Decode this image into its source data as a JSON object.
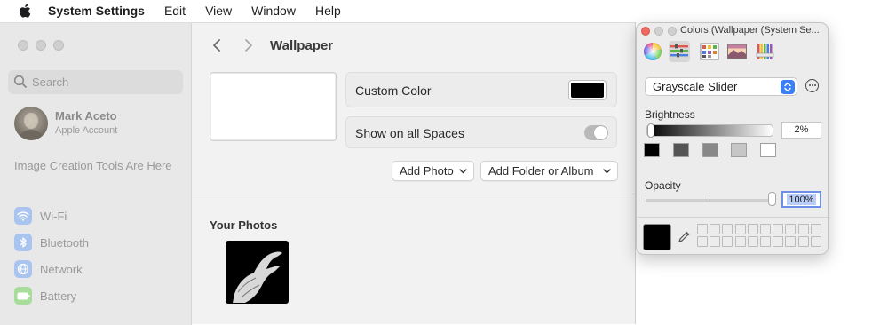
{
  "menubar": {
    "app_name": "System Settings",
    "items": [
      "Edit",
      "View",
      "Window",
      "Help"
    ]
  },
  "settings": {
    "search": {
      "placeholder": "Search"
    },
    "user": {
      "name": "Mark Aceto",
      "subtitle": "Apple Account"
    },
    "promo": "Image Creation Tools Are Here",
    "sidebar_items": [
      {
        "label": "Wi-Fi",
        "icon": "wifi-icon",
        "color": "#a9c4ee"
      },
      {
        "label": "Bluetooth",
        "icon": "bluetooth-icon",
        "color": "#a9c4ee"
      },
      {
        "label": "Network",
        "icon": "globe-icon",
        "color": "#a9c4ee"
      },
      {
        "label": "Battery",
        "icon": "battery-icon",
        "color": "#a8dc9b"
      }
    ],
    "content": {
      "title": "Wallpaper",
      "custom_color_label": "Custom Color",
      "custom_color_value": "#000000",
      "show_all_spaces_label": "Show on all Spaces",
      "show_all_spaces_on": true,
      "add_photo": "Add Photo",
      "add_folder": "Add Folder or Album",
      "your_photos": "Your Photos"
    }
  },
  "colors_panel": {
    "title": "Colors (Wallpaper (System Se...",
    "tabs": [
      "color-wheel-icon",
      "sliders-icon",
      "palettes-icon",
      "image-palette-icon",
      "pencils-icon"
    ],
    "selected_tab": 1,
    "slider_mode": "Grayscale Slider",
    "brightness_label": "Brightness",
    "brightness_value": "2%",
    "brightness_fraction": 0.02,
    "gray_swatches": [
      "#000000",
      "#555555",
      "#888888",
      "#c6c6c6",
      "#ffffff"
    ],
    "opacity_label": "Opacity",
    "opacity_value": "100%",
    "opacity_fraction": 1.0,
    "current_color": "#000000"
  }
}
